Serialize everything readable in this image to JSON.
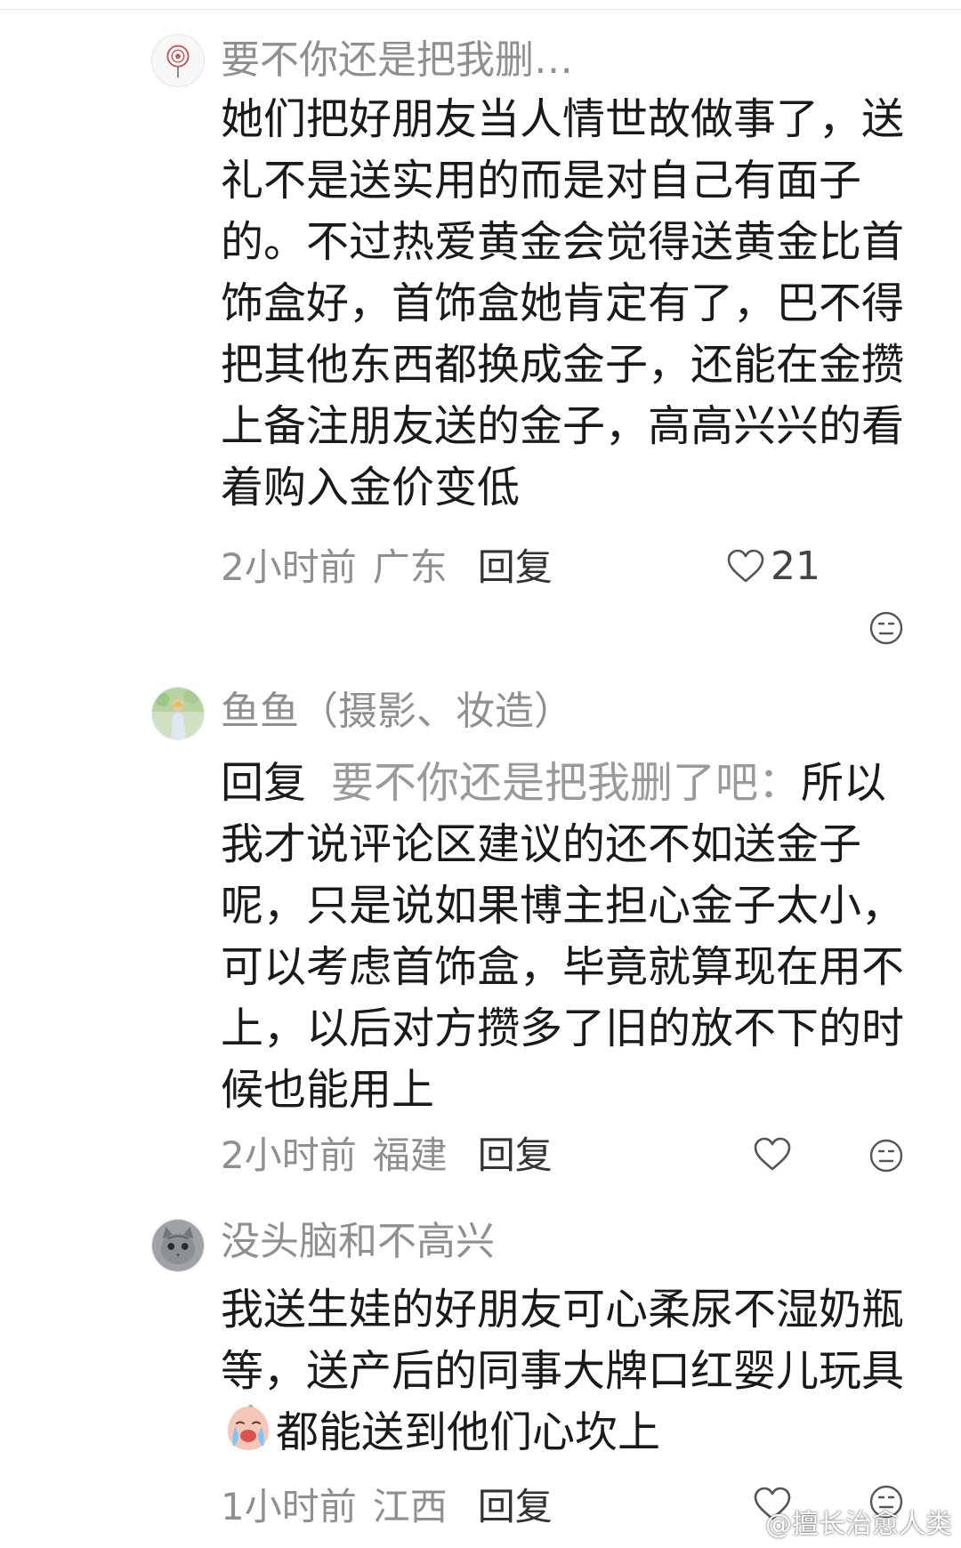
{
  "comments": [
    {
      "username": "要不你还是把我删…",
      "text": "她们把好朋友当人情世故做事了，送礼不是送实用的而是对自己有面子的。不过热爱黄金会觉得送黄金比首饰盒好，首饰盒她肯定有了，巴不得把其他东西都换成金子，还能在金攒上备注朋友送的金子，高高兴兴的看着购入金价变低",
      "time": "2小时前",
      "location": "广东",
      "reply_label": "回复",
      "likes": "21"
    },
    {
      "username": "鱼鱼（摄影、妆造）",
      "reply_prefix": "回复",
      "reply_to": "要不你还是把我删了吧：",
      "text": "所以我才说评论区建议的还不如送金子呢，只是说如果博主担心金子太小，可以考虑首饰盒，毕竟就算现在用不上，以后对方攒多了旧的放不下的时候也能用上",
      "time": "2小时前",
      "location": "福建",
      "reply_label": "回复",
      "likes": ""
    },
    {
      "username": "没头脑和不高兴",
      "text_before_emoji": "我送生娃的好朋友可心柔尿不湿奶瓶等，送产后的同事大牌口红婴儿玩具",
      "emoji": "crying-face-emoji",
      "text_after_emoji": "都能送到他们心坎上",
      "time": "1小时前",
      "location": "江西",
      "reply_label": "回复",
      "likes": ""
    }
  ],
  "watermark": {
    "text": "@擅长治愈人类",
    "icon": "weibo-logo"
  },
  "colors": {
    "username": "#8f8f8f",
    "body": "#1a1a1a",
    "meta": "#8f8f8f"
  }
}
